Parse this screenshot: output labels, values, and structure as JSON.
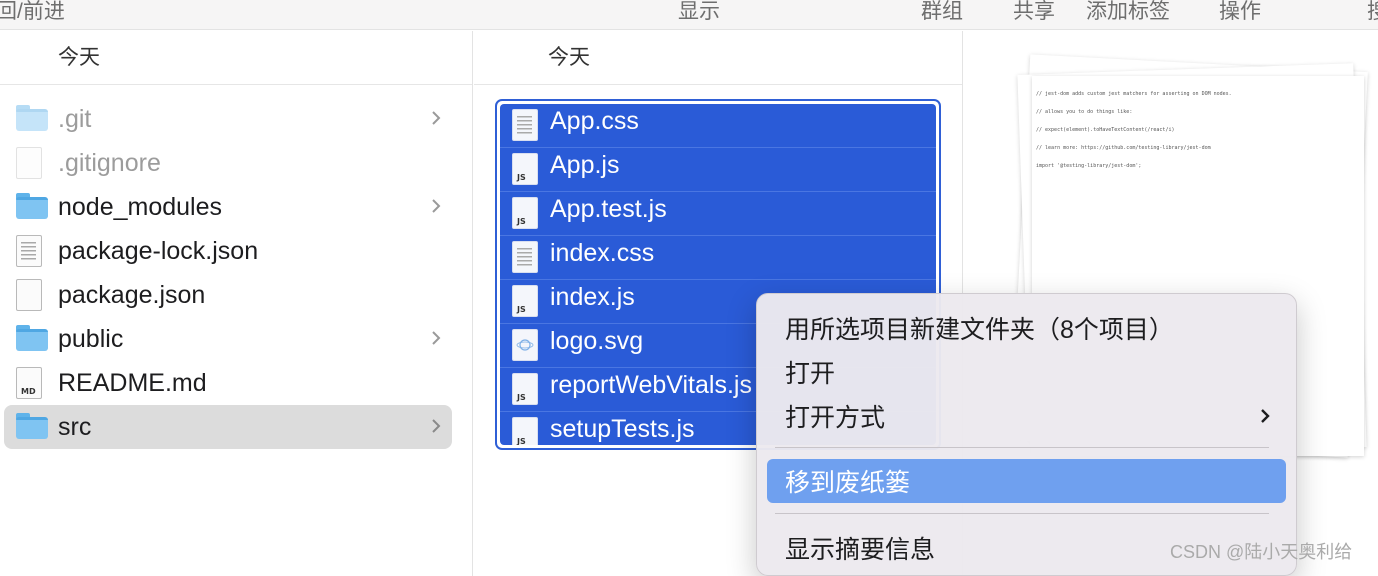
{
  "toolbar": {
    "back_forward": "回/前进",
    "display": "显示",
    "group": "群组",
    "share": "共享",
    "add_tags": "添加标签",
    "actions": "操作",
    "search_partial": "搜"
  },
  "column1": {
    "header": "今天",
    "items": [
      {
        "name": ".git",
        "type": "folder",
        "dim": true,
        "has_children": true
      },
      {
        "name": ".gitignore",
        "type": "file",
        "dim": true,
        "has_children": false
      },
      {
        "name": "node_modules",
        "type": "folder",
        "dim": false,
        "has_children": true
      },
      {
        "name": "package-lock.json",
        "type": "file",
        "dim": false,
        "has_children": false
      },
      {
        "name": "package.json",
        "type": "file",
        "dim": false,
        "has_children": false
      },
      {
        "name": "public",
        "type": "folder",
        "dim": false,
        "has_children": true
      },
      {
        "name": "README.md",
        "type": "md",
        "dim": false,
        "has_children": false
      },
      {
        "name": "src",
        "type": "folder",
        "dim": false,
        "has_children": true,
        "active": true
      }
    ]
  },
  "column2": {
    "header": "今天",
    "items": [
      {
        "name": "App.css",
        "icon": "css-file-icon"
      },
      {
        "name": "App.js",
        "icon": "js-file-icon"
      },
      {
        "name": "App.test.js",
        "icon": "js-file-icon"
      },
      {
        "name": "index.css",
        "icon": "css-file-icon"
      },
      {
        "name": "index.js",
        "icon": "js-file-icon"
      },
      {
        "name": "logo.svg",
        "icon": "svg-file-icon"
      },
      {
        "name": "reportWebVitals.js",
        "icon": "js-file-icon"
      },
      {
        "name": "setupTests.js",
        "icon": "js-file-icon"
      }
    ]
  },
  "context_menu": {
    "new_folder_with_selection": "用所选项目新建文件夹（8个项目）",
    "open": "打开",
    "open_with": "打开方式",
    "move_to_trash": "移到废纸篓",
    "get_summary_info": "显示摘要信息"
  },
  "preview": {
    "code_lines": [
      "// jest-dom adds custom jest matchers for asserting on DOM nodes.",
      "// allows you to do things like:",
      "// expect(element).toHaveTextContent(/react/i)",
      "// learn more: https://github.com/testing-library/jest-dom",
      "import '@testing-library/jest-dom';"
    ]
  },
  "watermark": "CSDN @陆小天奥利给",
  "colors": {
    "selection": "#2a5bd7",
    "menu_highlight": "#6fa0ef",
    "folder": "#7fc4f2"
  }
}
